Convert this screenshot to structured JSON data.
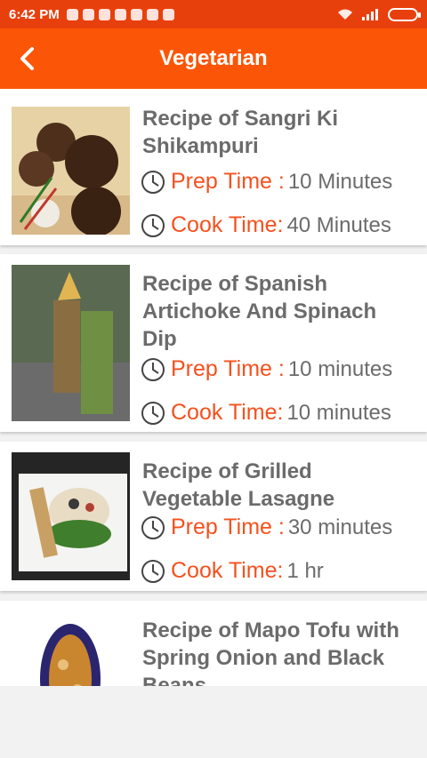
{
  "status_bar": {
    "time": "6:42 PM"
  },
  "app_bar": {
    "title": "Vegetarian"
  },
  "recipes": [
    {
      "title": "Recipe of Sangri Ki Shikampuri",
      "prep_label": "Prep Time :",
      "prep_value": "10 Minutes",
      "cook_label": "Cook Time:",
      "cook_value": "40 Minutes"
    },
    {
      "title": "Recipe of Spanish Artichoke And Spinach Dip",
      "prep_label": "Prep Time :",
      "prep_value": "10 minutes",
      "cook_label": "Cook Time:",
      "cook_value": "10 minutes"
    },
    {
      "title": "Recipe of Grilled Vegetable Lasagne",
      "prep_label": "Prep Time :",
      "prep_value": "30 minutes",
      "cook_label": "Cook Time:",
      "cook_value": "1 hr"
    },
    {
      "title": "Recipe of Mapo Tofu with Spring Onion and Black Beans"
    }
  ],
  "colors": {
    "status_bar": "#e8400d",
    "app_bar": "#fb5607",
    "accent_label": "#f4511e",
    "title_text": "#6b6b6b"
  },
  "icons": {
    "back": "chevron-left-icon",
    "clock": "clock-icon"
  }
}
